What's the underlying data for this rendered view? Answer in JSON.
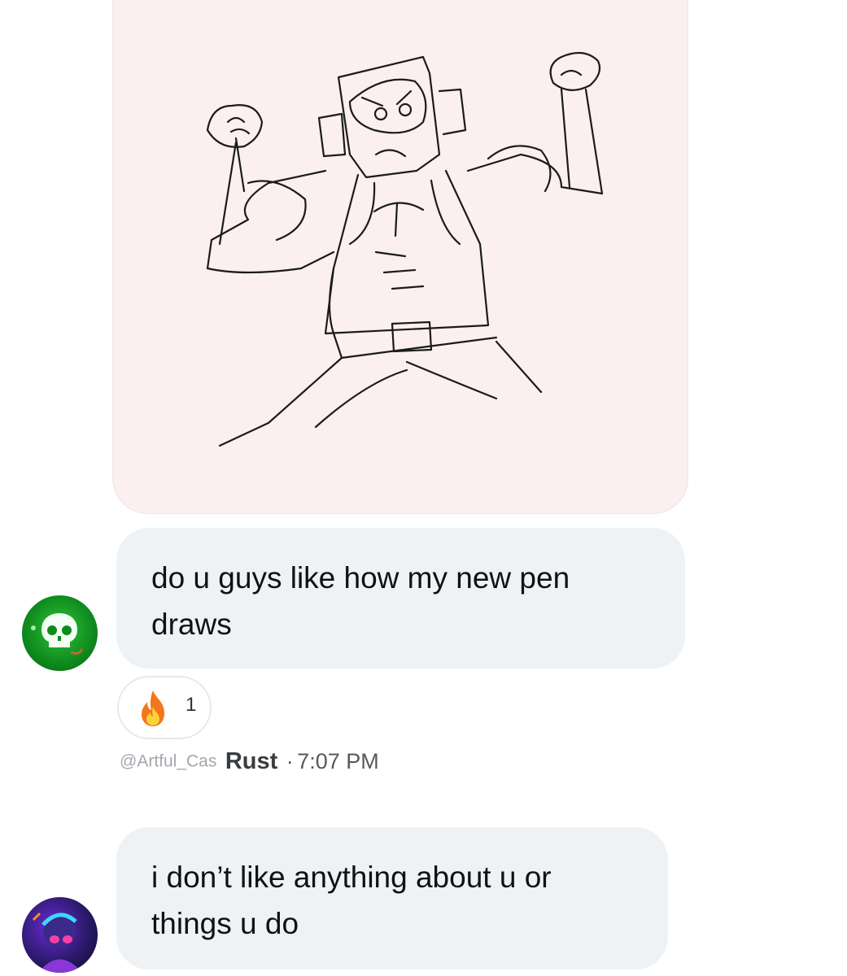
{
  "conversation": {
    "image_message": {
      "alt": "pen drawing"
    },
    "messages": [
      {
        "text_line_1": "do u guys like how my new pen",
        "text_line_2": "draws",
        "avatar_icon": "skull-icon",
        "reaction": {
          "emoji_icon": "fire-icon",
          "count": "1"
        },
        "meta": {
          "handle": "@Artful_Cas",
          "display_name": "Rust",
          "separator": "·",
          "time": "7:07 PM"
        }
      },
      {
        "text_line_1": "i don’t like anything about u or",
        "text_line_2": "things u do",
        "avatar_icon": "profile-avatar-icon"
      }
    ]
  },
  "colors": {
    "bubble_bg": "#eff2f5",
    "image_bg": "#fcefef",
    "meta_text": "#55595d",
    "handle_text": "#a3a8ad"
  }
}
